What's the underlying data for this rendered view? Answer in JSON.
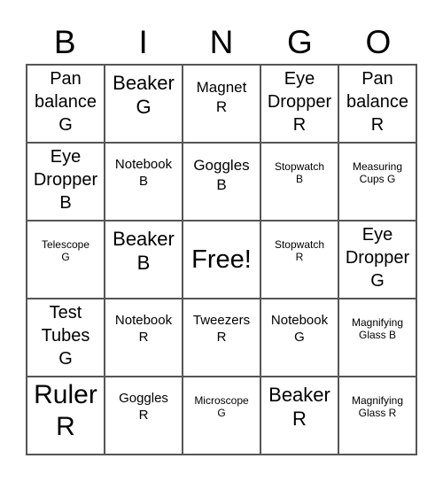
{
  "header": [
    "B",
    "I",
    "N",
    "G",
    "O"
  ],
  "rows": [
    [
      {
        "text": "Pan\nbalance\nG",
        "size": "s4"
      },
      {
        "text": "Beaker\nG",
        "size": "s5"
      },
      {
        "text": "Magnet\nR",
        "size": "s3"
      },
      {
        "text": "Eye\nDropper\nR",
        "size": "s4"
      },
      {
        "text": "Pan\nbalance\nR",
        "size": "s4"
      }
    ],
    [
      {
        "text": "Eye\nDropper\nB",
        "size": "s4"
      },
      {
        "text": "Notebook\nB",
        "size": "s2"
      },
      {
        "text": "Goggles\nB",
        "size": "s3"
      },
      {
        "text": "Stopwatch\nB",
        "size": "s1"
      },
      {
        "text": "Measuring\nCups G",
        "size": "s1"
      }
    ],
    [
      {
        "text": "Telescope\nG",
        "size": "s1"
      },
      {
        "text": "Beaker\nB",
        "size": "s5"
      },
      {
        "text": "Free!",
        "size": "s6"
      },
      {
        "text": "Stopwatch\nR",
        "size": "s1"
      },
      {
        "text": "Eye\nDropper\nG",
        "size": "s4"
      }
    ],
    [
      {
        "text": "Test\nTubes\nG",
        "size": "s4"
      },
      {
        "text": "Notebook\nR",
        "size": "s2"
      },
      {
        "text": "Tweezers\nR",
        "size": "s2"
      },
      {
        "text": "Notebook\nG",
        "size": "s2"
      },
      {
        "text": "Magnifying\nGlass B",
        "size": "s1"
      }
    ],
    [
      {
        "text": "Ruler\nR",
        "size": "s7"
      },
      {
        "text": "Goggles\nR",
        "size": "s2"
      },
      {
        "text": "Microscope\nG",
        "size": "s1"
      },
      {
        "text": "Beaker\nR",
        "size": "s5"
      },
      {
        "text": "Magnifying\nGlass R",
        "size": "s1"
      }
    ]
  ]
}
